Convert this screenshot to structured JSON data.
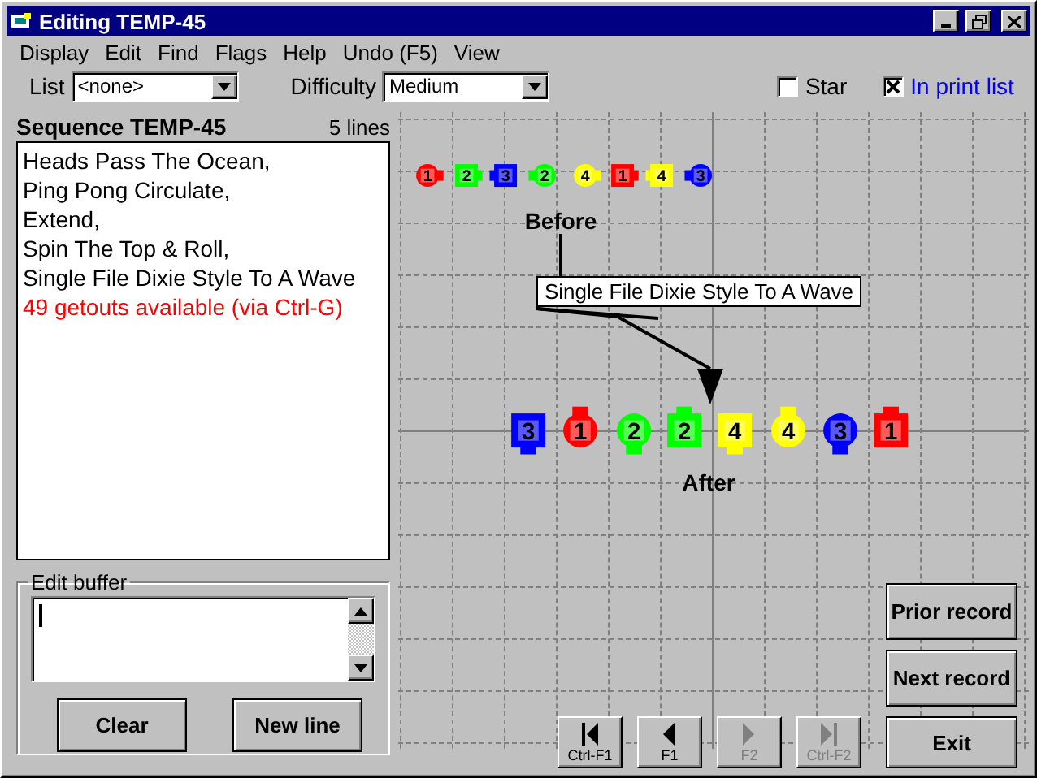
{
  "window": {
    "title": "Editing TEMP-45"
  },
  "menu": [
    "Display",
    "Edit",
    "Find",
    "Flags",
    "Help",
    "Undo (F5)",
    "View"
  ],
  "toolbar": {
    "list": {
      "label": "List",
      "value": "<none>"
    },
    "difficulty": {
      "label": "Difficulty",
      "value": "Medium"
    },
    "checkboxes": [
      {
        "label": "Star",
        "checked": false,
        "link": false
      },
      {
        "label": "In print list",
        "checked": true,
        "link": true
      }
    ]
  },
  "sequence": {
    "title": "Sequence TEMP-45",
    "count": "5 lines",
    "lines": [
      {
        "text": "Heads Pass The Ocean,",
        "kind": "call"
      },
      {
        "text": "Ping Pong Circulate,",
        "kind": "call"
      },
      {
        "text": "Extend,",
        "kind": "call"
      },
      {
        "text": "Spin The Top & Roll,",
        "kind": "call"
      },
      {
        "text": "Single File Dixie Style To A Wave",
        "kind": "call"
      },
      {
        "text": "49 getouts available (via Ctrl-G)",
        "kind": "note"
      }
    ]
  },
  "edit_buffer": {
    "label": "Edit buffer",
    "buttons": [
      "Clear",
      "New line"
    ]
  },
  "diagram": {
    "before_label": "Before",
    "after_label": "After",
    "callout": "Single File Dixie Style To A Wave",
    "before": [
      {
        "number": "1",
        "kind": "girl",
        "color": "#ff0000",
        "faces": {
          "left": false,
          "right": true,
          "up": false,
          "down": false
        }
      },
      {
        "number": "2",
        "kind": "boy",
        "color": "#00ff00",
        "faces": {
          "left": false,
          "right": true,
          "up": false,
          "down": false
        }
      },
      {
        "number": "3",
        "kind": "boy",
        "color": "#0000ff",
        "faces": {
          "left": true,
          "right": false,
          "up": false,
          "down": false
        }
      },
      {
        "number": "2",
        "kind": "girl",
        "color": "#00ff00",
        "faces": {
          "left": true,
          "right": false,
          "up": false,
          "down": false
        }
      },
      {
        "number": "4",
        "kind": "girl",
        "color": "#ffff00",
        "faces": {
          "left": false,
          "right": true,
          "up": false,
          "down": false
        }
      },
      {
        "number": "1",
        "kind": "boy",
        "color": "#ff0000",
        "faces": {
          "left": false,
          "right": true,
          "up": false,
          "down": false
        }
      },
      {
        "number": "4",
        "kind": "boy",
        "color": "#ffff00",
        "faces": {
          "left": true,
          "right": false,
          "up": false,
          "down": false
        }
      },
      {
        "number": "3",
        "kind": "girl",
        "color": "#0000ff",
        "faces": {
          "left": true,
          "right": false,
          "up": false,
          "down": false
        }
      }
    ],
    "after": [
      {
        "number": "3",
        "kind": "boy",
        "color": "#0000ff",
        "faces": {
          "left": false,
          "right": false,
          "up": false,
          "down": true
        }
      },
      {
        "number": "1",
        "kind": "girl",
        "color": "#ff0000",
        "faces": {
          "left": false,
          "right": false,
          "up": true,
          "down": false
        }
      },
      {
        "number": "2",
        "kind": "girl",
        "color": "#00ff00",
        "faces": {
          "left": false,
          "right": false,
          "up": false,
          "down": true
        }
      },
      {
        "number": "2",
        "kind": "boy",
        "color": "#00ff00",
        "faces": {
          "left": false,
          "right": false,
          "up": true,
          "down": false
        }
      },
      {
        "number": "4",
        "kind": "boy",
        "color": "#ffff00",
        "faces": {
          "left": false,
          "right": false,
          "up": false,
          "down": true
        }
      },
      {
        "number": "4",
        "kind": "girl",
        "color": "#ffff00",
        "faces": {
          "left": false,
          "right": false,
          "up": true,
          "down": false
        }
      },
      {
        "number": "3",
        "kind": "girl",
        "color": "#0000ff",
        "faces": {
          "left": false,
          "right": false,
          "up": false,
          "down": true
        }
      },
      {
        "number": "1",
        "kind": "boy",
        "color": "#ff0000",
        "faces": {
          "left": false,
          "right": false,
          "up": true,
          "down": false
        }
      }
    ]
  },
  "navigation": [
    {
      "kind": "first",
      "label": "Ctrl-F1",
      "disabled": false
    },
    {
      "kind": "previous",
      "label": "F1",
      "disabled": false
    },
    {
      "kind": "next",
      "label": "F2",
      "disabled": true
    },
    {
      "kind": "last",
      "label": "Ctrl-F2",
      "disabled": true
    }
  ],
  "record_buttons": [
    "Prior record",
    "Next record",
    "Exit"
  ]
}
